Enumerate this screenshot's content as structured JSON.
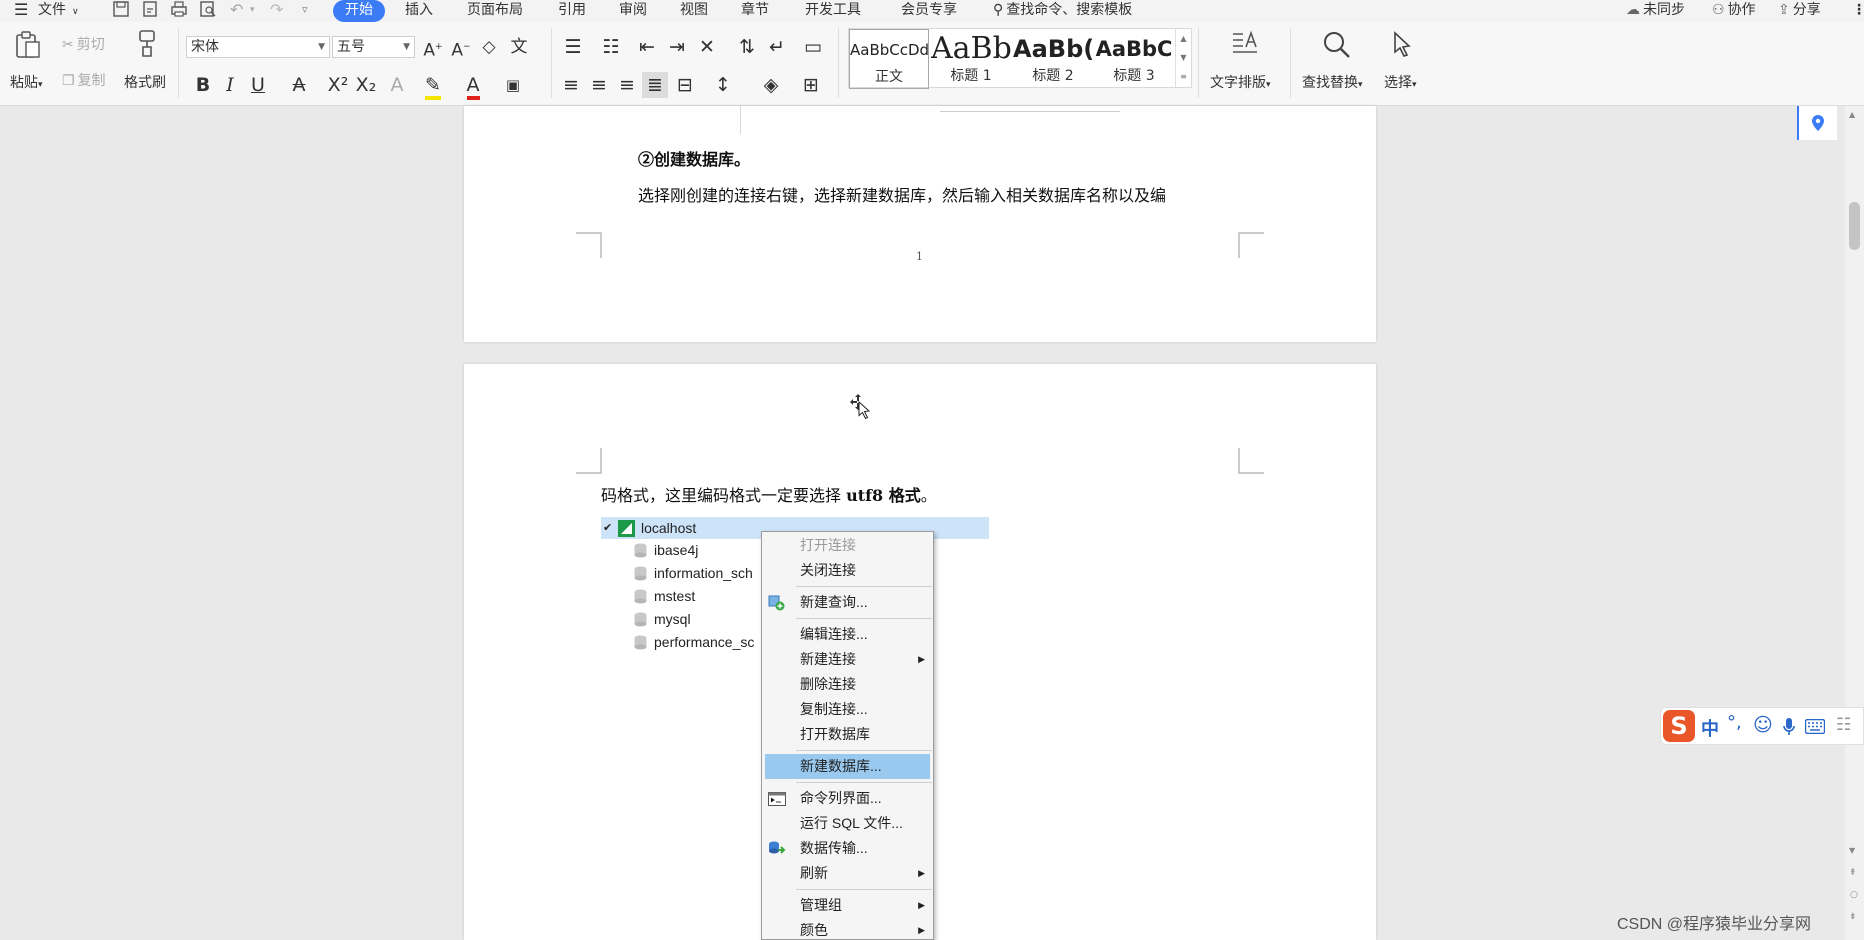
{
  "menubar": {
    "file_label": "文件",
    "tabs": [
      "开始",
      "插入",
      "页面布局",
      "引用",
      "审阅",
      "视图",
      "章节",
      "开发工具",
      "会员专享"
    ],
    "search_placeholder": "查找命令、搜索模板",
    "sync_label": "未同步",
    "collab_label": "协作",
    "share_label": "分享"
  },
  "ribbon": {
    "paste_label": "粘贴",
    "cut_label": "剪切",
    "copy_label": "复制",
    "format_painter_label": "格式刷",
    "font_name": "宋体",
    "font_size": "五号",
    "styles": [
      {
        "sample": "AaBbCcDd",
        "label": "正文"
      },
      {
        "sample": "AaBb",
        "label": "标题 1"
      },
      {
        "sample": "AaBb(",
        "label": "标题 2"
      },
      {
        "sample": "AaBbC",
        "label": "标题 3"
      }
    ],
    "text_layout_label": "文字排版",
    "find_replace_label": "查找替换",
    "select_label": "选择"
  },
  "document": {
    "page1": {
      "heading": "②创建数据库。",
      "paragraph": "选择刚创建的连接右键，选择新建数据库，然后输入相关数据库名称以及编",
      "page_number": "1"
    },
    "page2": {
      "paragraph_prefix": "码格式，这里编码格式一定要选择 ",
      "paragraph_bold": "utf8 格式",
      "paragraph_suffix": "。"
    }
  },
  "embedded_screenshot": {
    "connection": "localhost",
    "databases": [
      "ibase4j",
      "information_sch",
      "mstest",
      "mysql",
      "performance_sc"
    ],
    "context_menu": [
      {
        "label": "打开连接",
        "disabled": true
      },
      {
        "label": "关闭连接"
      },
      {
        "label": "新建查询..."
      },
      {
        "label": "编辑连接..."
      },
      {
        "label": "新建连接",
        "submenu": true
      },
      {
        "label": "删除连接"
      },
      {
        "label": "复制连接..."
      },
      {
        "label": "打开数据库"
      },
      {
        "label": "新建数据库...",
        "highlighted": true
      },
      {
        "label": "命令列界面..."
      },
      {
        "label": "运行 SQL 文件..."
      },
      {
        "label": "数据传输..."
      },
      {
        "label": "刷新",
        "submenu": true
      },
      {
        "label": "管理组",
        "submenu": true
      },
      {
        "label": "颜色",
        "submenu": true
      }
    ]
  },
  "watermark": "CSDN @程序猿毕业分享网",
  "ime": {
    "lang": "中"
  },
  "colors": {
    "accent": "#3b7cf6",
    "menu_highlight": "#99c9ef",
    "tree_selection": "#cde3f8"
  }
}
